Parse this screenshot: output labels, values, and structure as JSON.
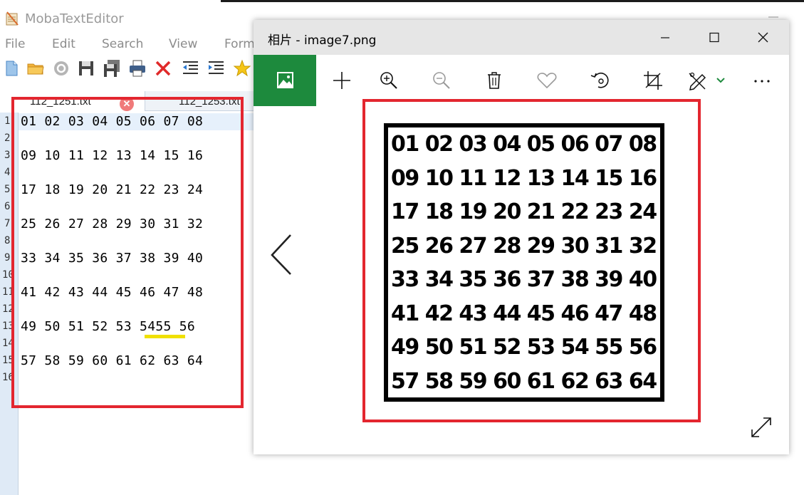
{
  "editor": {
    "app_title": "MobaTextEditor",
    "menu": [
      "File",
      "Edit",
      "Search",
      "View",
      "Form"
    ],
    "toolbar_icons": [
      "new-file-icon",
      "open-folder-icon",
      "reload-icon",
      "save-icon",
      "save-all-icon",
      "print-icon",
      "close-icon",
      "unindent-icon",
      "indent-icon",
      "highlight-icon"
    ],
    "tabs": [
      {
        "label": "112_1251.txt",
        "active": true
      },
      {
        "label": "112_1253.txt",
        "active": false
      }
    ],
    "line_numbers": [
      "1",
      "2",
      "3",
      "4",
      "5",
      "6",
      "7",
      "8",
      "9",
      "10",
      "11",
      "12",
      "13",
      "14",
      "15",
      "16"
    ],
    "lines": [
      "01 02 03 04 05 06 07 08",
      "",
      "09 10 11 12 13 14 15 16",
      "",
      "17 18 19 20 21 22 23 24",
      "",
      "25 26 27 28 29 30 31 32",
      "",
      "33 34 35 36 37 38 39 40",
      "",
      "41 42 43 44 45 46 47 48",
      "",
      "49 50 51 52 53 5455 56",
      "",
      "57 58 59 60 61 62 63 64",
      ""
    ]
  },
  "photos": {
    "title": "相片 - image7.png",
    "toolbar_icons": [
      "gallery-icon",
      "add-icon",
      "zoom-in-icon",
      "zoom-out-icon",
      "delete-icon",
      "favorite-icon",
      "rotate-icon",
      "crop-icon",
      "edit-icon",
      "more-icon"
    ],
    "image_rows": [
      "01 02 03 04 05 06 07 08",
      "09 10 11 12 13 14 15 16",
      "17 18 19 20 21 22 23 24",
      "25 26 27 28 29 30 31 32",
      "33 34 35 36 37 38 39 40",
      "41 42 43 44 45 46 47 48",
      "49 50 51 52 53 54 55 56",
      "57 58 59 60 61 62 63 64"
    ]
  },
  "colors": {
    "annotation_box": "#e3262f",
    "highlight_underline": "#f0e000",
    "gallery_green": "#1d8a3d"
  }
}
